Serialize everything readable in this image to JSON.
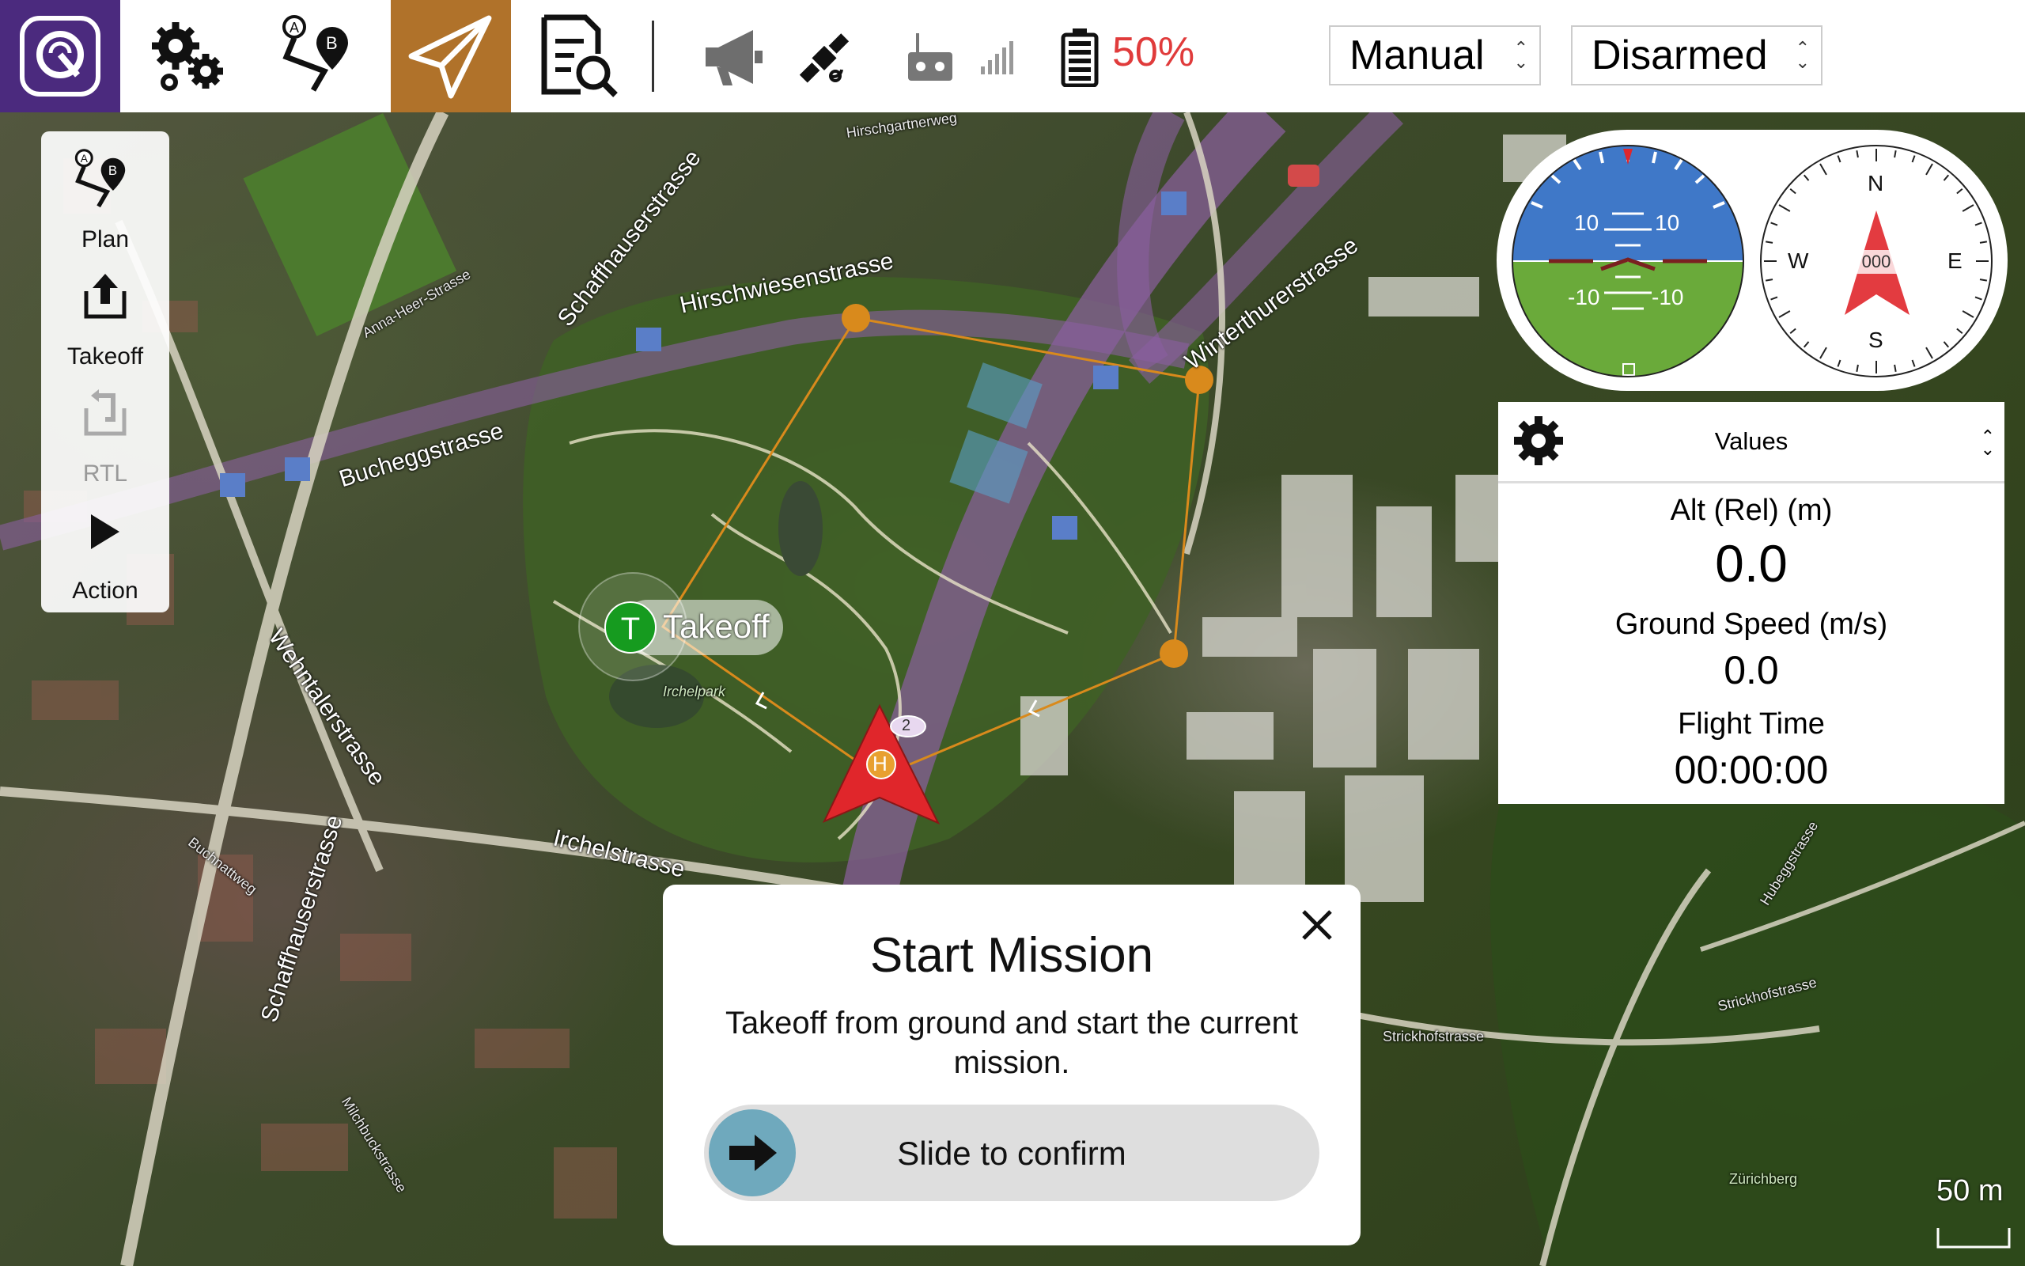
{
  "toolbar": {
    "logo_icon": "qgc-logo-icon",
    "buttons": [
      {
        "name": "settings",
        "icon": "gears-icon"
      },
      {
        "name": "plan",
        "icon": "plan-route-icon"
      },
      {
        "name": "fly",
        "icon": "paper-plane-icon",
        "active": true
      },
      {
        "name": "analyze",
        "icon": "document-search-icon"
      }
    ],
    "status_icons": [
      "megaphone-icon",
      "satellite-icon",
      "rc-remote-icon",
      "signal-bars-icon",
      "battery-icon"
    ],
    "battery_text": "50%",
    "battery_color": "#e03b3b",
    "flight_mode": "Manual",
    "arm_state": "Disarmed"
  },
  "toolstrip": {
    "items": [
      {
        "label": "Plan",
        "icon": "plan-route-icon",
        "enabled": true
      },
      {
        "label": "Takeoff",
        "icon": "takeoff-icon",
        "enabled": true
      },
      {
        "label": "RTL",
        "icon": "rtl-icon",
        "enabled": false
      },
      {
        "label": "Action",
        "icon": "play-icon",
        "enabled": true
      }
    ]
  },
  "attitude": {
    "pitch_labels": [
      "10",
      "10",
      "-10",
      "-10"
    ],
    "sky_color": "#3f78c8",
    "ground_color": "#6aaa3a"
  },
  "compass": {
    "n": "N",
    "s": "S",
    "e": "E",
    "w": "W",
    "heading": "000"
  },
  "values_panel": {
    "title": "Values",
    "items": [
      {
        "label": "Alt (Rel) (m)",
        "value": "0.0"
      },
      {
        "label": "Ground Speed (m/s)",
        "value": "0.0"
      },
      {
        "label": "Flight Time",
        "value": "00:00:00"
      }
    ]
  },
  "map": {
    "streets": {
      "hirschwiesenstrasse": "Hirschwiesenstrasse",
      "winterthurerstrasse": "Winterthurerstrasse",
      "bucheggstrasse": "Bucheggstrasse",
      "schaffhauserstrasse_1": "Schaffhauserstrasse",
      "schaffhauserstrasse_2": "Schaffhauserstrasse",
      "wehntalerstrasse": "Wehntalerstrasse",
      "irchelstrasse": "Irchelstrasse",
      "hirschgartnerweg": "Hirschgartnerweg",
      "anna_heer": "Anna-Heer-Strasse",
      "strickhofstrasse_1": "Strickhofstrasse",
      "strickhofstrasse_2": "Strickhofstrasse",
      "zurichberg": "Zürichberg",
      "irchelpark": "Irchelpark",
      "buchnatweg": "Buchnattweg",
      "hubeggstrasse": "Hubeggstrasse",
      "milchbuckstrasse": "Milchbuckstrasse"
    },
    "takeoff_label": "Takeoff",
    "takeoff_letter": "T",
    "home_letter": "H",
    "waypoint_number": "2",
    "scale_text": "50 m",
    "route_color": "#d98a1c"
  },
  "dialog": {
    "title": "Start Mission",
    "message": "Takeoff from ground and start the current mission.",
    "slider_text": "Slide to confirm"
  }
}
